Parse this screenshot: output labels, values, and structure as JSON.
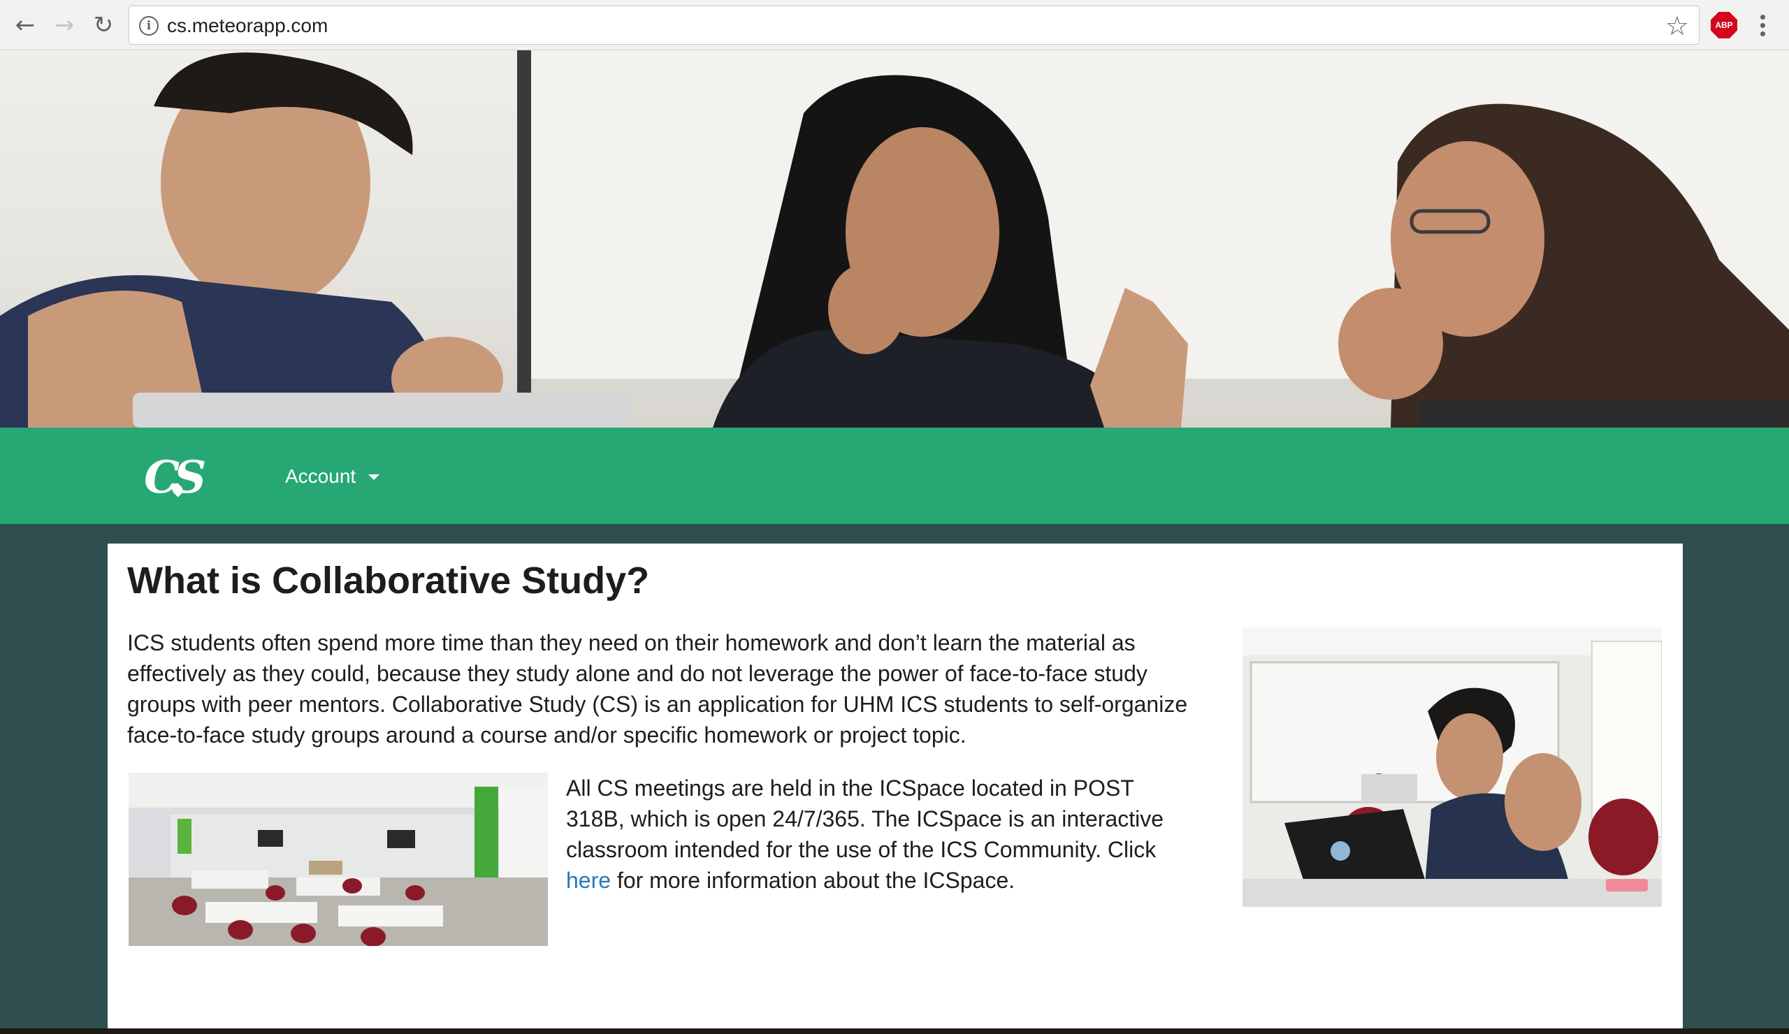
{
  "browser": {
    "url": "cs.meteorapp.com",
    "icons": [
      "back-arrow-icon",
      "forward-arrow-icon",
      "reload-icon",
      "info-icon",
      "star-icon",
      "adblock-plus-icon",
      "more-vert-icon"
    ],
    "adblock_label": "ABP"
  },
  "nav": {
    "logo_text": "CS",
    "account_label": "Account",
    "brand_color": "#26a774"
  },
  "main": {
    "title": "What is Collaborative Study?",
    "intro": "ICS students often spend more time than they need on their homework and don’t learn the material as effectively as they could, because they study alone and do not leverage the power of face-to-face study groups with peer mentors. Collaborative Study (CS) is an application for UHM ICS students to self-organize face-to-face study groups around a course and/or specific homework or project topic.",
    "meeting_before": "All CS meetings are held in the ICSpace located in POST 318B, which is open 24/7/365. The ICSpace is an interactive classroom intended for the use of the ICS Community. Click ",
    "meeting_link": "here",
    "meeting_after": " for more information about the ICSpace.",
    "link_color": "#2a7ab8"
  },
  "colors": {
    "page_background": "#2f4f4f",
    "card_background": "#ffffff"
  }
}
